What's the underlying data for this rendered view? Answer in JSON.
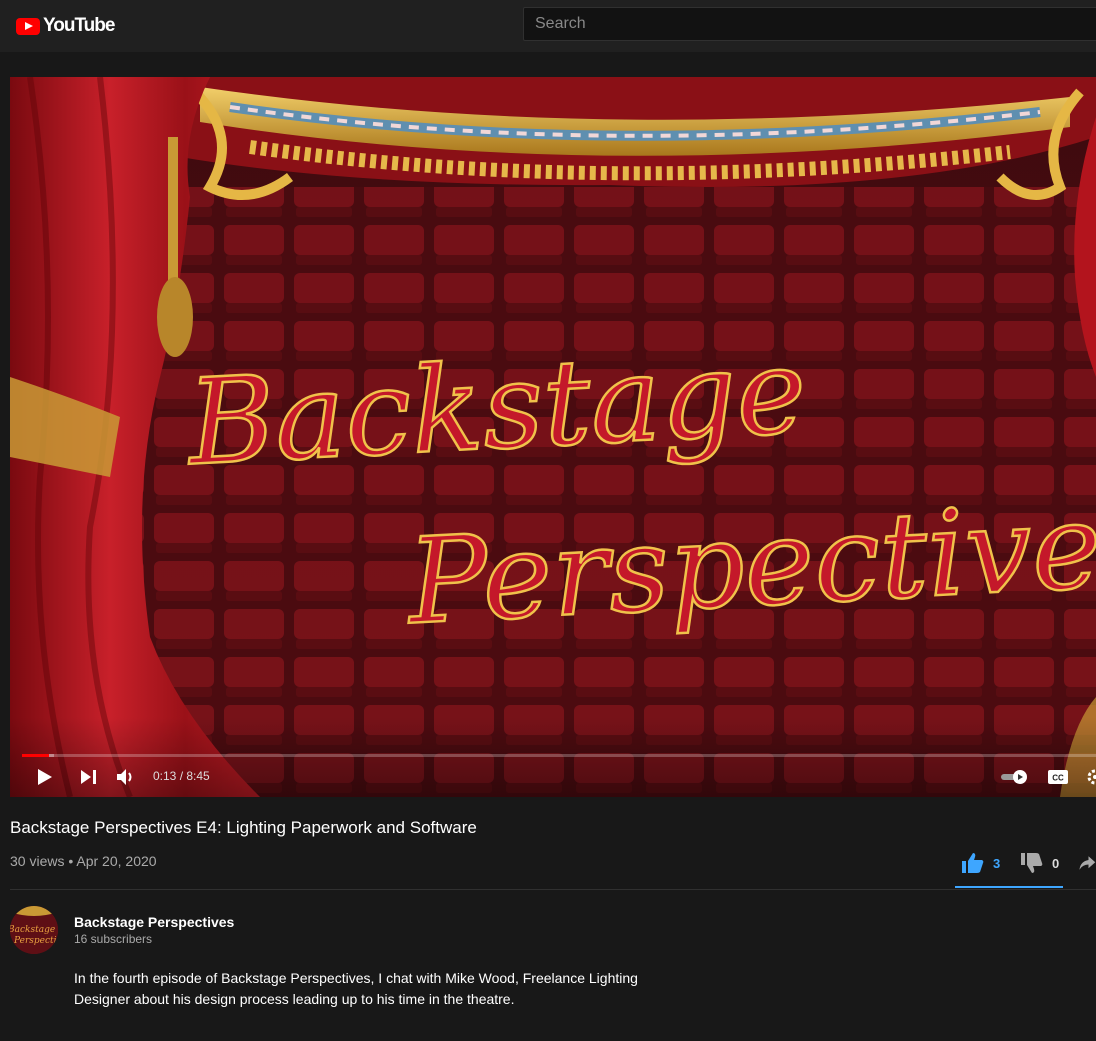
{
  "header": {
    "logo_text": "YouTube",
    "search_placeholder": "Search"
  },
  "player": {
    "overlay_line1": "Backstage",
    "overlay_line2": "Perspectives",
    "time": "0:13 / 8:45",
    "progress_played_fraction": 0.025,
    "progress_buffered_fraction": 0.03,
    "colors": {
      "progress": "#ff0000",
      "curtain": "#b3141d",
      "seats": "#6b1017",
      "gold": "#d9a83a"
    }
  },
  "video": {
    "title": "Backstage Perspectives E4: Lighting Paperwork and Software",
    "meta": "30 views • Apr 20, 2020",
    "likes": "3",
    "dislikes": "0",
    "like_color": "#3ea6ff"
  },
  "channel": {
    "name": "Backstage Perspectives",
    "subscribers": "16 subscribers",
    "avatar_text_1": "Backstage",
    "avatar_text_2": "Perspectives"
  },
  "description": {
    "line1": "In the fourth episode of Backstage Perspectives, I chat with Mike Wood, Freelance Lighting",
    "line2": "Designer about his design process leading up to his time in the theatre."
  },
  "icons": [
    "youtube-logo-icon",
    "play-icon",
    "next-icon",
    "volume-icon",
    "autoplay-toggle-icon",
    "cc-icon",
    "settings-icon",
    "like-icon",
    "dislike-icon",
    "share-icon"
  ]
}
